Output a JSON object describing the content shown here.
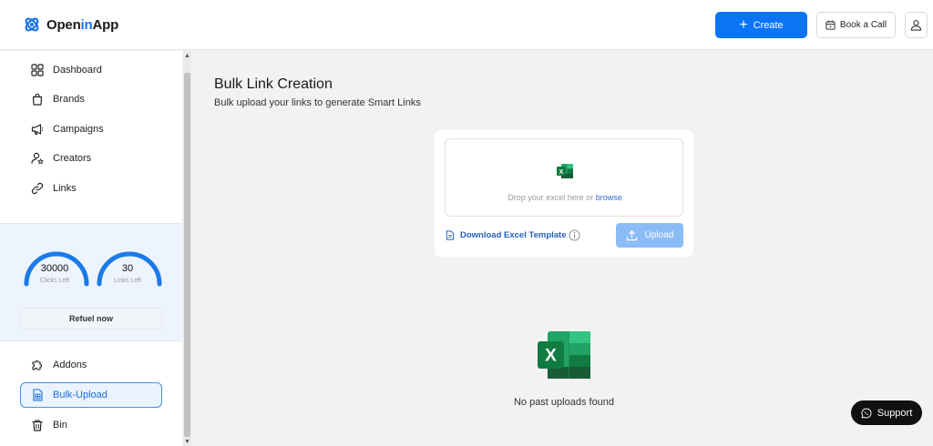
{
  "header": {
    "logo_prefix": "Open",
    "logo_accent": "in",
    "logo_suffix": "App",
    "create_label": "Create",
    "book_call_label": "Book a Call"
  },
  "sidebar": {
    "items": [
      {
        "label": "Dashboard",
        "icon": "grid-icon"
      },
      {
        "label": "Brands",
        "icon": "shopping-bag-icon"
      },
      {
        "label": "Campaigns",
        "icon": "megaphone-icon"
      },
      {
        "label": "Creators",
        "icon": "user-star-icon"
      },
      {
        "label": "Links",
        "icon": "link-icon"
      }
    ],
    "credits": {
      "clicks_value": "30000",
      "clicks_label": "Clicks Left",
      "links_value": "30",
      "links_label": "Links Left",
      "refuel_label": "Refuel now"
    },
    "bottom_items": [
      {
        "label": "Addons",
        "icon": "puzzle-icon"
      },
      {
        "label": "Bulk-Upload",
        "icon": "spreadsheet-icon",
        "active": true
      },
      {
        "label": "Bin",
        "icon": "trash-icon"
      }
    ]
  },
  "main": {
    "title": "Bulk Link Creation",
    "subtitle": "Bulk upload your links to generate Smart Links",
    "dropzone_text": "Drop your excel here or",
    "dropzone_link": "browse",
    "download_template_label": "Download Excel Template",
    "upload_label": "Upload",
    "empty_text": "No past uploads found"
  },
  "support_label": "Support",
  "colors": {
    "primary": "#0a74f5",
    "excel_green": "#1d7a46",
    "active_bg": "#eaf3ff",
    "gauge_blue": "#1a7ae8"
  }
}
